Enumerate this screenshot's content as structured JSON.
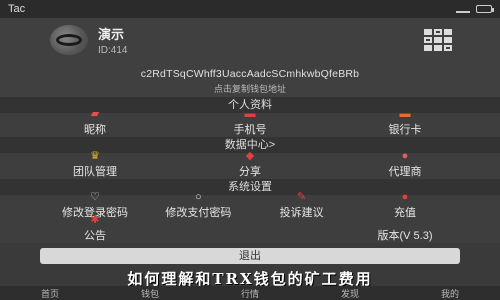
{
  "status_bar": {
    "carrier": "Tac"
  },
  "profile": {
    "name": "演示",
    "id": "ID:414"
  },
  "wallet": {
    "address": "c2RdTSqCWhff3UaccAadcSCmhkwbQfeBRb",
    "hint": "点击复制钱包地址"
  },
  "sections": {
    "personal": {
      "title": "个人资料",
      "items": [
        {
          "label": "昵称",
          "icon": "id-card-icon",
          "color": "#e05050"
        },
        {
          "label": "手机号",
          "icon": "phone-icon",
          "color": "#e04040"
        },
        {
          "label": "银行卡",
          "icon": "bank-card-icon",
          "color": "#e07030"
        }
      ]
    },
    "data_center": {
      "title": "数据中心>",
      "items": [
        {
          "label": "团队管理",
          "icon": "crown-icon",
          "color": "#e0b030"
        },
        {
          "label": "分享",
          "icon": "share-icon",
          "color": "#e04040"
        },
        {
          "label": "代理商",
          "icon": "agent-icon",
          "color": "#e06060"
        }
      ]
    },
    "settings": {
      "title": "系统设置",
      "items": [
        {
          "label": "修改登录密码",
          "icon": "lock-icon",
          "color": "#dddddd"
        },
        {
          "label": "修改支付密码",
          "icon": "key-icon",
          "color": "#dddddd"
        },
        {
          "label": "投诉建议",
          "icon": "feedback-icon",
          "color": "#e04040"
        },
        {
          "label": "充值",
          "icon": "recharge-icon",
          "color": "#e04040"
        },
        {
          "label": "公告",
          "icon": "announcement-icon",
          "color": "#e04040"
        },
        {
          "label": "版本(V 5.3)",
          "icon": "",
          "color": "#dddddd"
        }
      ]
    }
  },
  "exit_label": "退出",
  "headline": "如何理解和TRX钱包的矿工费用",
  "bottom_nav": [
    "首页",
    "钱包",
    "行情",
    "发现",
    "我的"
  ]
}
